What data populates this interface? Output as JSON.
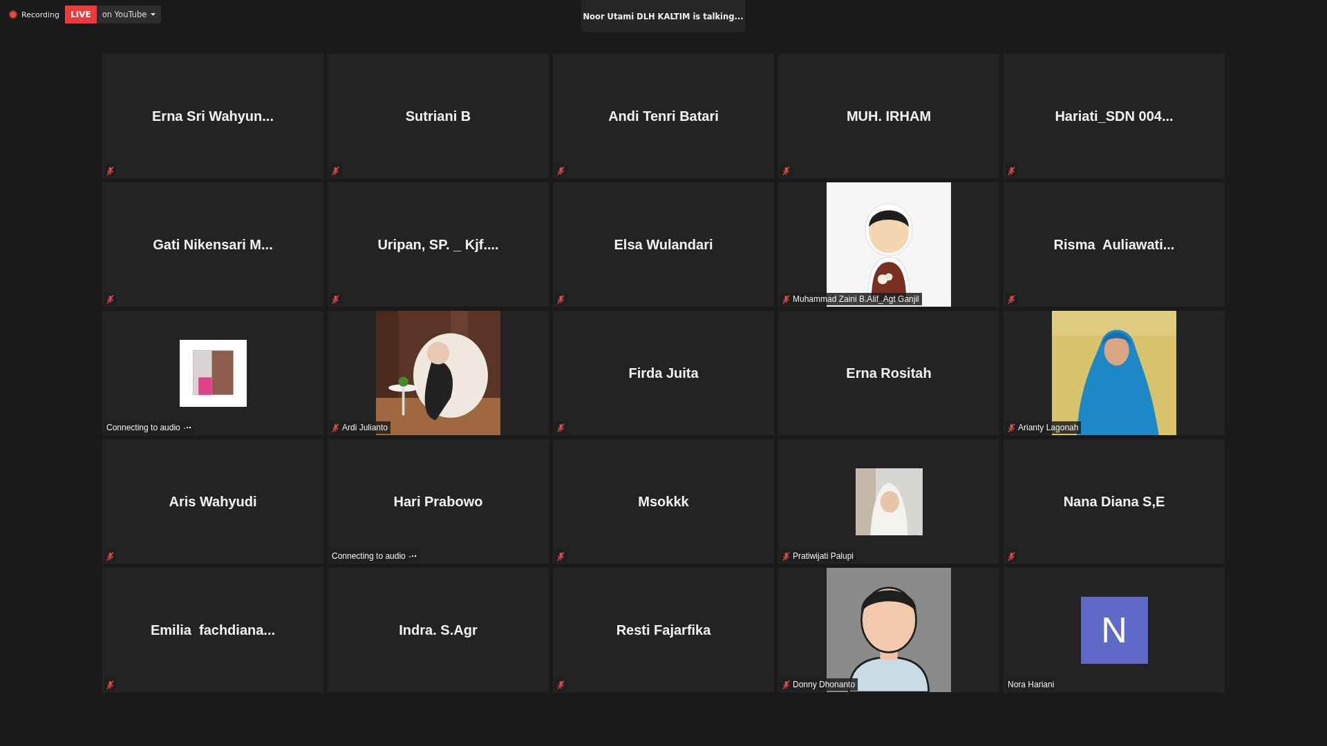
{
  "recording": {
    "label": "Recording",
    "on": true
  },
  "live": {
    "badge": "LIVE",
    "destination": "on YouTube"
  },
  "talking": "Noor Utami DLH KALTIM is talking...",
  "tiles": [
    {
      "kind": "name",
      "name": "Erna Sri Wahyun...",
      "muted": true
    },
    {
      "kind": "name",
      "name": "Sutriani B",
      "muted": true
    },
    {
      "kind": "name",
      "name": "Andi Tenri Batari",
      "muted": true
    },
    {
      "kind": "name",
      "name": "MUH. IRHAM",
      "muted": true
    },
    {
      "kind": "name",
      "name": "Hariati_SDN 004...",
      "muted": true
    },
    {
      "kind": "name",
      "name": "Gati Nikensari M...",
      "muted": true
    },
    {
      "kind": "name",
      "name": "Uripan, SP. _ Kjf....",
      "muted": true
    },
    {
      "kind": "name",
      "name": "Elsa Wulandari",
      "muted": true
    },
    {
      "label": "Muhammad Zaini B.Alif_Agt Ganjil",
      "muted": true
    },
    {
      "kind": "name",
      "name": "Risma  Auliawati...",
      "muted": true
    },
    {
      "kind": "thumbnail",
      "label": "Connecting to audio",
      "connecting": true,
      "muted": false
    },
    {
      "label": "Ardi Julianto",
      "muted": true
    },
    {
      "kind": "name",
      "name": "Firda Juita",
      "muted": true
    },
    {
      "kind": "name",
      "name": "Erna Rositah",
      "muted": false
    },
    {
      "label": "Arianty Lagonah",
      "muted": true
    },
    {
      "kind": "name",
      "name": "Aris Wahyudi",
      "muted": true
    },
    {
      "kind": "name",
      "name": "Hari Prabowo",
      "label": "Connecting to audio",
      "connecting": true,
      "muted": false
    },
    {
      "kind": "name",
      "name": "Msokkk",
      "muted": true
    },
    {
      "kind": "thumbnail",
      "label": "Pratiwijati Palupi",
      "muted": true
    },
    {
      "kind": "name",
      "name": "Nana Diana S,E",
      "muted": true
    },
    {
      "kind": "name",
      "name": "Emilia  fachdiana...",
      "muted": true
    },
    {
      "kind": "name",
      "name": "Indra. S.Agr",
      "muted": false
    },
    {
      "kind": "name",
      "name": "Resti Fajarfika",
      "muted": true
    },
    {
      "label": "Donny Dhonanto",
      "muted": true
    },
    {
      "kind": "initial",
      "initial": "N",
      "label": "Nora Hariani",
      "muted": false
    }
  ]
}
